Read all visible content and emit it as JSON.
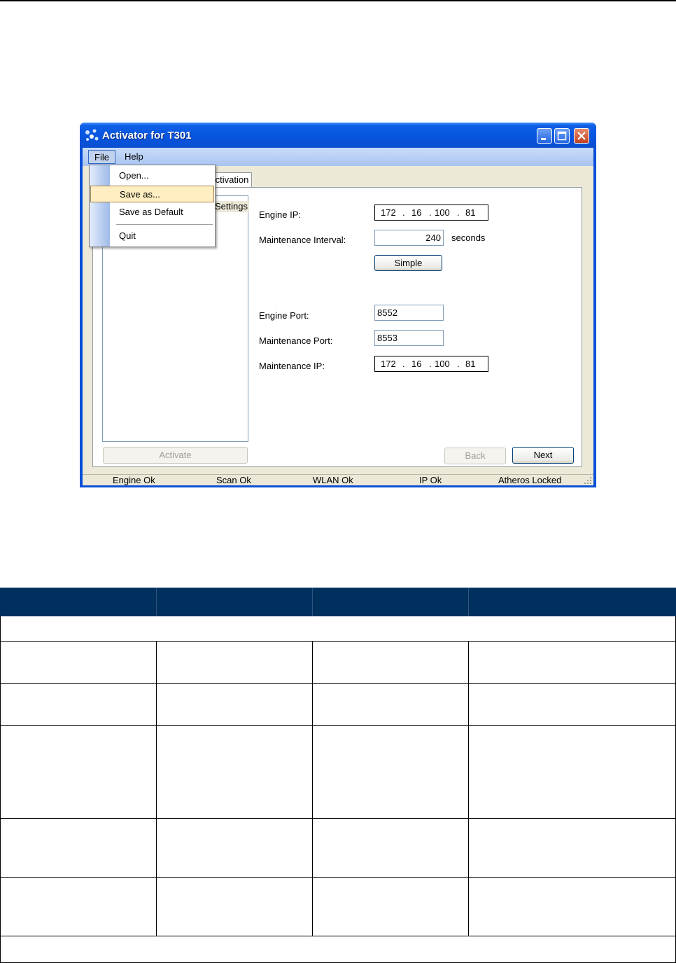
{
  "window": {
    "title": "Activator for T301",
    "menu": {
      "file": "File",
      "help": "Help"
    },
    "file_menu_items": [
      "Open...",
      "Save as...",
      "Save as Default",
      "Quit"
    ],
    "tab_label": "Activation",
    "tree_item": "Settings",
    "fields": {
      "engine_ip_label": "Engine IP:",
      "engine_ip": [
        "172",
        "16",
        "100",
        "81"
      ],
      "maintenance_interval_label": "Maintenance Interval:",
      "maintenance_interval_value": "240",
      "maintenance_interval_unit": "seconds",
      "engine_port_label": "Engine Port:",
      "engine_port_value": "8552",
      "maintenance_port_label": "Maintenance Port:",
      "maintenance_port_value": "8553",
      "maintenance_ip_label": "Maintenance IP:",
      "maintenance_ip": [
        "172",
        "16",
        "100",
        "81"
      ]
    },
    "buttons": {
      "simple": "Simple",
      "activate": "Activate",
      "back": "Back",
      "next": "Next"
    },
    "status": [
      "Engine Ok",
      "Scan Ok",
      "WLAN Ok",
      "IP Ok",
      "Atheros Locked"
    ]
  },
  "table": {
    "header_color": "#00305e",
    "columns": [
      "",
      "",
      "",
      ""
    ],
    "rows": 5
  }
}
